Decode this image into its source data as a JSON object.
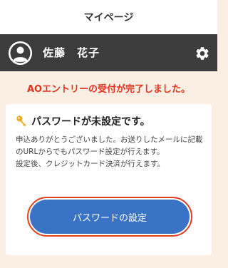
{
  "header": {
    "title": "マイページ"
  },
  "user_bar": {
    "name": "佐藤　花子",
    "avatar_icon": "user-avatar-icon",
    "settings_icon": "gear-icon"
  },
  "notice": {
    "text": "AOエントリーの受付が完了しました。",
    "color": "#e0321e"
  },
  "card": {
    "icon": "key-icon",
    "title": "パスワードが未設定です。",
    "body_line1": "申込ありがとうございました。お送りしたメールに記載のURLからでもパスワード設定が行えます。",
    "body_line2": "設定後、クレジットカード決済が行えます。",
    "button_label": "パスワードの設定",
    "button_color": "#3a73c5",
    "highlight_color": "#e2401e"
  },
  "colors": {
    "page_background": "#fbeee3",
    "user_bar_background": "#3c3c3c"
  }
}
